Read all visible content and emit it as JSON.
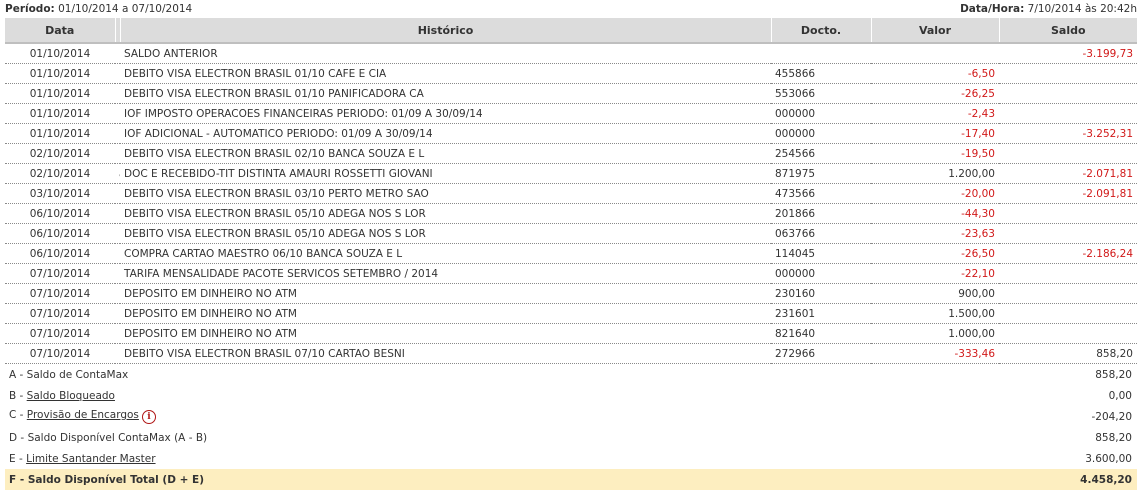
{
  "header": {
    "period_label": "Período:",
    "period_value": "01/10/2014 a 07/10/2014",
    "datetime_label": "Data/Hora:",
    "datetime_value": "7/10/2014 às 20:42h"
  },
  "columns": {
    "date": "Data",
    "history": "Histórico",
    "doc": "Docto.",
    "value": "Valor",
    "balance": "Saldo"
  },
  "rows": [
    {
      "date": "01/10/2014",
      "flag": "",
      "history": "SALDO ANTERIOR",
      "doc": "",
      "value": "",
      "balance": "-3.199,73"
    },
    {
      "date": "01/10/2014",
      "flag": "",
      "history": "DEBITO VISA ELECTRON BRASIL 01/10 CAFE E CIA",
      "doc": "455866",
      "value": "-6,50",
      "balance": ""
    },
    {
      "date": "01/10/2014",
      "flag": "",
      "history": "DEBITO VISA ELECTRON BRASIL 01/10 PANIFICADORA CA",
      "doc": "553066",
      "value": "-26,25",
      "balance": ""
    },
    {
      "date": "01/10/2014",
      "flag": "",
      "history": "IOF IMPOSTO OPERACOES FINANCEIRAS PERIODO: 01/09 A 30/09/14",
      "doc": "000000",
      "value": "-2,43",
      "balance": ""
    },
    {
      "date": "01/10/2014",
      "flag": "",
      "history": "IOF ADICIONAL - AUTOMATICO PERIODO: 01/09 A 30/09/14",
      "doc": "000000",
      "value": "-17,40",
      "balance": "-3.252,31"
    },
    {
      "date": "02/10/2014",
      "flag": "",
      "history": "DEBITO VISA ELECTRON BRASIL 02/10 BANCA SOUZA E L",
      "doc": "254566",
      "value": "-19,50",
      "balance": ""
    },
    {
      "date": "02/10/2014",
      "flag": "a",
      "history": "DOC E RECEBIDO-TIT DISTINTA AMAURI ROSSETTI GIOVANI",
      "doc": "871975",
      "value": "1.200,00",
      "balance": "-2.071,81"
    },
    {
      "date": "03/10/2014",
      "flag": "",
      "history": "DEBITO VISA ELECTRON BRASIL 03/10 PERTO METRO SAO",
      "doc": "473566",
      "value": "-20,00",
      "balance": "-2.091,81"
    },
    {
      "date": "06/10/2014",
      "flag": "",
      "history": "DEBITO VISA ELECTRON BRASIL 05/10 ADEGA NOS S LOR",
      "doc": "201866",
      "value": "-44,30",
      "balance": ""
    },
    {
      "date": "06/10/2014",
      "flag": "",
      "history": "DEBITO VISA ELECTRON BRASIL 05/10 ADEGA NOS S LOR",
      "doc": "063766",
      "value": "-23,63",
      "balance": ""
    },
    {
      "date": "06/10/2014",
      "flag": "",
      "history": "COMPRA CARTAO MAESTRO 06/10 BANCA SOUZA E L",
      "doc": "114045",
      "value": "-26,50",
      "balance": "-2.186,24"
    },
    {
      "date": "07/10/2014",
      "flag": "",
      "history": "TARIFA MENSALIDADE PACOTE SERVICOS SETEMBRO / 2014",
      "doc": "000000",
      "value": "-22,10",
      "balance": ""
    },
    {
      "date": "07/10/2014",
      "flag": "",
      "history": "DEPOSITO EM DINHEIRO NO ATM",
      "doc": "230160",
      "value": "900,00",
      "balance": ""
    },
    {
      "date": "07/10/2014",
      "flag": "",
      "history": "DEPOSITO EM DINHEIRO NO ATM",
      "doc": "231601",
      "value": "1.500,00",
      "balance": ""
    },
    {
      "date": "07/10/2014",
      "flag": "",
      "history": "DEPOSITO EM DINHEIRO NO ATM",
      "doc": "821640",
      "value": "1.000,00",
      "balance": ""
    },
    {
      "date": "07/10/2014",
      "flag": "",
      "history": "DEBITO VISA ELECTRON BRASIL 07/10 CARTAO BESNI",
      "doc": "272966",
      "value": "-333,46",
      "balance": "858,20"
    }
  ],
  "summary": [
    {
      "prefix": "A - ",
      "label": "Saldo de ContaMax",
      "link": false,
      "info": false,
      "amount": "858,20"
    },
    {
      "prefix": "B - ",
      "label": "Saldo Bloqueado",
      "link": true,
      "info": false,
      "amount": "0,00"
    },
    {
      "prefix": "C - ",
      "label": "Provisão de Encargos",
      "link": true,
      "info": true,
      "amount": "-204,20"
    },
    {
      "prefix": "D - ",
      "label": "Saldo Disponível ContaMax (A - B)",
      "link": false,
      "info": false,
      "amount": "858,20"
    },
    {
      "prefix": "E - ",
      "label": "Limite Santander Master",
      "link": true,
      "info": false,
      "amount": "3.600,00"
    },
    {
      "prefix": "F - ",
      "label": "Saldo Disponível Total (D + E)",
      "link": false,
      "info": false,
      "amount": "4.458,20",
      "total": true
    }
  ],
  "icons": {
    "info": "info-icon"
  },
  "colors": {
    "negative": "#d11818",
    "header_bg": "#dcdcdc",
    "total_bg": "#fdeec0"
  }
}
